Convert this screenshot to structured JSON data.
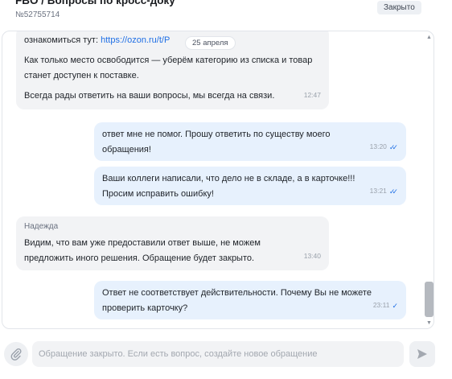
{
  "header": {
    "title": "FBO / Вопросы по кросс-доку",
    "ticket_no": "№52755714",
    "status": "Закрыто"
  },
  "messages": [
    {
      "direction": "incoming",
      "line1_prefix": "ознакомиться тут: ",
      "line1_link": "https://ozon.ru/t/P",
      "para1": "Как только место освободится — уберём категорию из списка и товар станет доступен к поставке.",
      "para2": "Всегда рады ответить на ваши вопросы, мы всегда на связи.",
      "time": "12:47"
    },
    {
      "direction": "outgoing",
      "text": "ответ мне не помог. Прошу ответить по существу моего обращения!",
      "time": "13:20",
      "status": "read"
    },
    {
      "direction": "outgoing",
      "text_line1": "Ваши коллеги написали, что дело не в складе, а в карточке!!!",
      "text_line2": "Просим исправить ошибку!",
      "time": "13:21",
      "status": "read"
    },
    {
      "direction": "incoming",
      "author": "Надежда",
      "text": "Видим, что вам уже предоставили ответ выше, не можем предложить иного решения. Обращение будет закрыто.",
      "time": "13:40"
    },
    {
      "direction": "outgoing",
      "text": "Ответ не соответствует действительности. Почему Вы не можете проверить карточку?",
      "time": "23:11",
      "status": "delivered"
    }
  ],
  "date_separator": "25 апреля",
  "composer": {
    "placeholder": "Обращение закрыто. Если есть вопрос, создайте новое обращение",
    "attach_icon": "paperclip-icon",
    "send_icon": "send-icon"
  },
  "colors": {
    "outgoing_bubble": "#e7f1fd",
    "incoming_bubble": "#f2f3f5",
    "accent": "#1f6fe5"
  }
}
